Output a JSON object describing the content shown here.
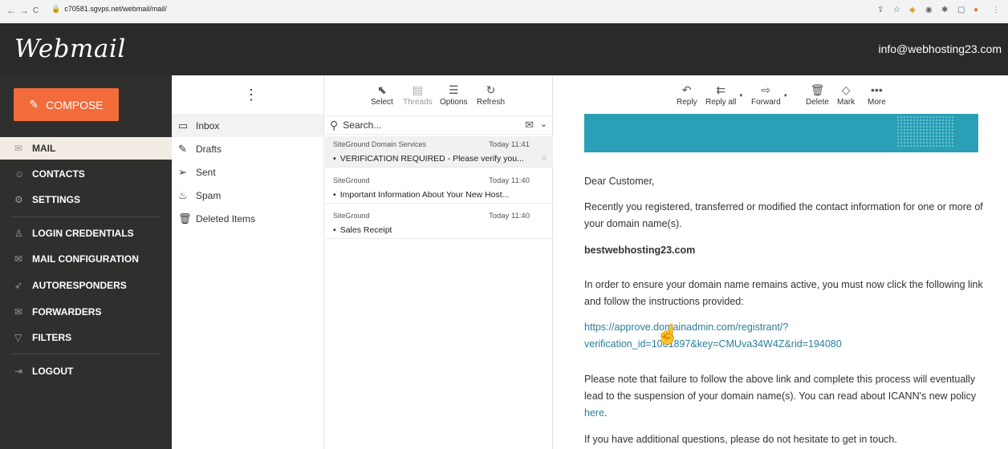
{
  "browser": {
    "url": "c70581.sgvps.net/webmail/mail/",
    "nav_back": "←",
    "nav_forward": "→",
    "nav_reload": "C"
  },
  "app": {
    "logo": "Webmail",
    "account": "info@webhosting23.com"
  },
  "sidebar": {
    "compose_label": "COMPOSE",
    "items": [
      {
        "label": "MAIL",
        "icon": "envelope-icon",
        "active": true
      },
      {
        "label": "CONTACTS",
        "icon": "contacts-icon"
      },
      {
        "label": "SETTINGS",
        "icon": "gear-icon"
      },
      {
        "label": "LOGIN CREDENTIALS",
        "icon": "user-icon"
      },
      {
        "label": "MAIL CONFIGURATION",
        "icon": "mail-config-icon"
      },
      {
        "label": "AUTORESPONDERS",
        "icon": "send-icon"
      },
      {
        "label": "FORWARDERS",
        "icon": "forward-mail-icon"
      },
      {
        "label": "FILTERS",
        "icon": "filter-icon"
      },
      {
        "label": "LOGOUT",
        "icon": "logout-icon"
      }
    ]
  },
  "folders": [
    {
      "label": "Inbox",
      "icon": "inbox-icon",
      "selected": true
    },
    {
      "label": "Drafts",
      "icon": "pencil-icon"
    },
    {
      "label": "Sent",
      "icon": "send-icon"
    },
    {
      "label": "Spam",
      "icon": "spam-icon"
    },
    {
      "label": "Deleted Items",
      "icon": "trash-icon"
    }
  ],
  "list_toolbar": {
    "select": "Select",
    "threads": "Threads",
    "options": "Options",
    "refresh": "Refresh"
  },
  "search": {
    "placeholder": "Search..."
  },
  "messages": [
    {
      "from": "SiteGround Domain Services",
      "date": "Today 11:41",
      "subject": "VERIFICATION REQUIRED - Please verify you...",
      "selected": true,
      "attachment": true
    },
    {
      "from": "SiteGround",
      "date": "Today 11:40",
      "subject": "Important Information About Your New Host..."
    },
    {
      "from": "SiteGround",
      "date": "Today 11:40",
      "subject": "Sales Receipt"
    }
  ],
  "reader_toolbar": {
    "reply": "Reply",
    "reply_all": "Reply all",
    "forward": "Forward",
    "delete": "Delete",
    "mark": "Mark",
    "more": "More"
  },
  "email": {
    "greeting": "Dear Customer,",
    "p1": "Recently you registered, transferred or modified the contact information for one or more of your domain name(s).",
    "domain": "bestwebhosting23.com",
    "p2": "In order to ensure your domain name remains active, you must now click the following link and follow the instructions provided:",
    "link_line1": "https://approve.domainadmin.com/registrant/?",
    "link_line2": "verification_id=1001897&key=CMUva34W4Z&rid=194080",
    "p3": "Please note that failure to follow the above link and complete this process will eventually lead to the suspension of your domain name(s). You can read about ICANN's new policy",
    "p3_link": "here",
    "p3_end": ".",
    "p4": "If you have additional questions, please do not hesitate to get in touch."
  },
  "colors": {
    "header_bg": "#2a2a2a",
    "sidebar_bg": "#2f2f2e",
    "compose_bg": "#f26b3a",
    "banner": "#2a9fb5",
    "link": "#2a7e9a"
  }
}
